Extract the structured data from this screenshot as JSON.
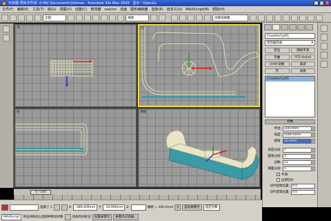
{
  "window": {
    "title": "无标题    项目文件夹: d:\\My Documents\\3dsmax    - Autodesk 3ds Max  2009    - 显示 : OpenGL",
    "minimize": "_",
    "maximize": "□",
    "close": "×"
  },
  "menu": [
    "文件(F)",
    "编辑(E)",
    "工具(T)",
    "组(G)",
    "视图(V)",
    "创建(C)",
    "修改器",
    "reactor",
    "动画",
    "图形编辑器",
    "渲染(R)",
    "自定义(U)",
    "MAXScript(M)",
    "帮助(H)"
  ],
  "toolbar": {
    "filter_select": "全部",
    "view_select": "视图",
    "named_sel": "创建选择集"
  },
  "viewports": {
    "top": "顶",
    "front": "前",
    "left": "左",
    "persp": "透视"
  },
  "panel": {
    "object_name": "ChamferCyl01",
    "modifier_list": "修改器列表",
    "modifiers": [
      "挤出",
      "网格平滑",
      "弯曲",
      "FFD 4x4x4",
      "UVW 贴图",
      "噪波",
      "壳",
      "晶格"
    ],
    "stack_item": "ChamferCyl01",
    "params_header": "参数",
    "params": [
      {
        "label": "半径:",
        "value": "100.0mm"
      },
      {
        "label": "高度:",
        "value": "5000.0mm"
      },
      {
        "label": "圆角:",
        "value": "10.0mm"
      }
    ],
    "segs": [
      {
        "label": "高度分段:",
        "value": "1"
      },
      {
        "label": "圆角分段:",
        "value": "1"
      },
      {
        "label": "边数:",
        "value": "12"
      },
      {
        "label": "端面分段:",
        "value": "1"
      }
    ],
    "smooth_label": "平滑",
    "slice_on_label": "启用切片",
    "slice_from_label": "切片起始位置:",
    "slice_from_value": "0.0",
    "slice_to_label": "切片结束位置:",
    "slice_to_value": "0.0"
  },
  "timeline": {
    "frame_display": "0 / 100"
  },
  "status": {
    "maxscript": "MAXScript",
    "selected": "选择了 1",
    "x_label": "X:",
    "x_value": "-389.409mm",
    "y_label": "Y:",
    "y_value": "-34.906mm",
    "z_label": "Z:",
    "grid": "栅格 = 100.0mm",
    "autokey": "自动关键点",
    "selected_set": "选定对象",
    "setkey": "设置关键点",
    "key_filter": "关键点过滤器...",
    "prompt": "单击并拖动以选择并移动对象",
    "add_time_tag": "添加时间标记",
    "frame": "0"
  },
  "colors": {
    "titlebar": "#1c44b4",
    "viewport_bg": "#9a9a9a",
    "active_border": "#f0e040",
    "object_teal": "#3a9aa6",
    "object_cream": "#e8e4c4"
  }
}
